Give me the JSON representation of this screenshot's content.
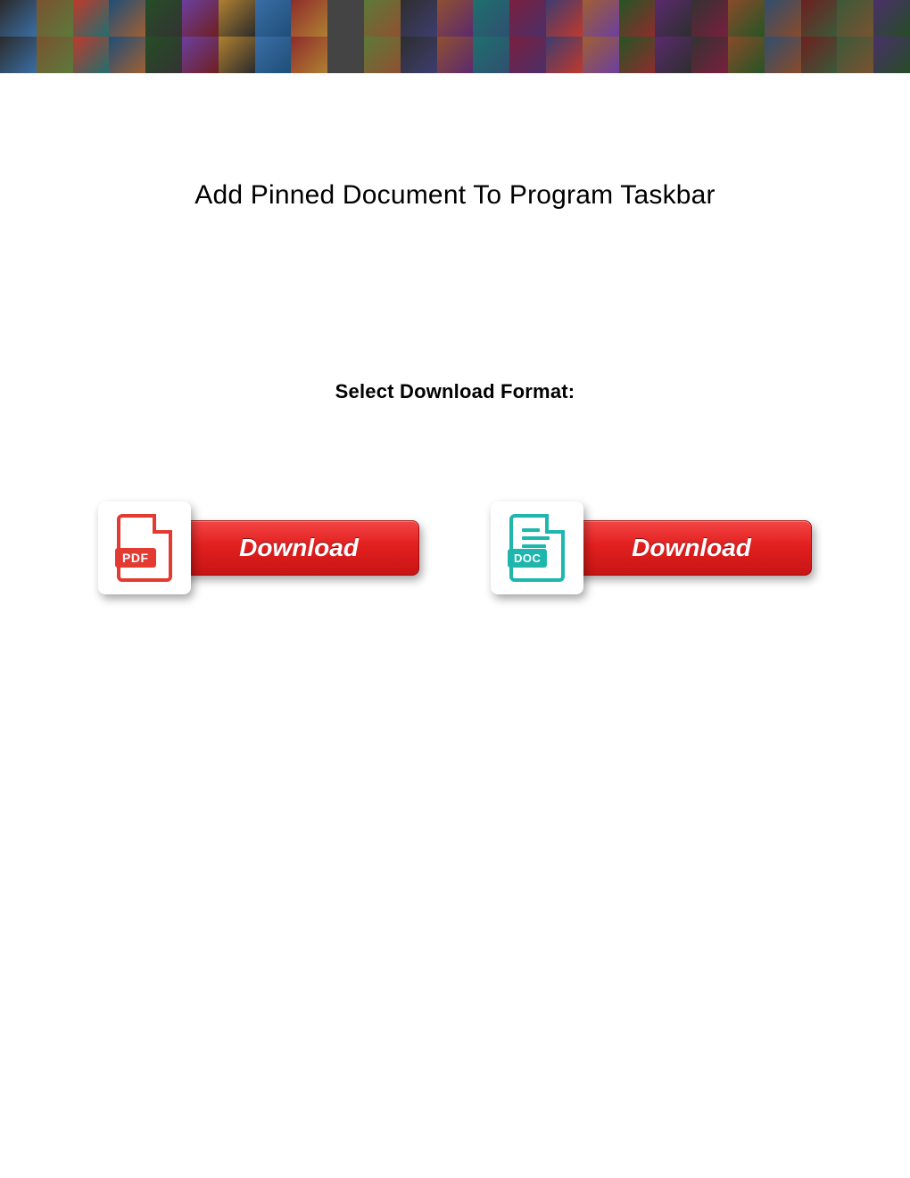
{
  "header": {
    "banner_tile_count": 50,
    "banner_palette": [
      "#2b2b2b",
      "#7a5230",
      "#c0392b",
      "#1e4e79",
      "#264d26",
      "#6b3fa0",
      "#b08030",
      "#3a6ea5",
      "#8e2c2c",
      "#444444",
      "#5c7a3a",
      "#2e2e2e",
      "#905030",
      "#1f6f6f",
      "#7a1f3d",
      "#3d3d70",
      "#a06030",
      "#255525",
      "#5a2a6e",
      "#333333",
      "#8a4a2a",
      "#2f4f6f",
      "#6e1f1f",
      "#3a5a3a",
      "#4a2f6a"
    ]
  },
  "title": "Add Pinned Document To Program Taskbar",
  "subtitle": "Select Download Format:",
  "downloads": {
    "pdf": {
      "icon_label": "PDF",
      "button_label": "Download"
    },
    "doc": {
      "icon_label": "DOC",
      "button_label": "Download"
    }
  }
}
